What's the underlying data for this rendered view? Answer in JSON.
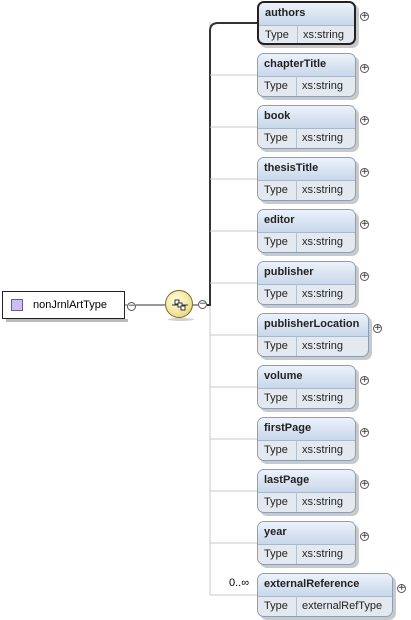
{
  "root_type": {
    "name": "nonJrnlArtType"
  },
  "elements": [
    {
      "name": "authors",
      "type_label": "Type",
      "type_value": "xs:string",
      "selected": true
    },
    {
      "name": "chapterTitle",
      "type_label": "Type",
      "type_value": "xs:string"
    },
    {
      "name": "book",
      "type_label": "Type",
      "type_value": "xs:string"
    },
    {
      "name": "thesisTitle",
      "type_label": "Type",
      "type_value": "xs:string"
    },
    {
      "name": "editor",
      "type_label": "Type",
      "type_value": "xs:string"
    },
    {
      "name": "publisher",
      "type_label": "Type",
      "type_value": "xs:string"
    },
    {
      "name": "publisherLocation",
      "type_label": "Type",
      "type_value": "xs:string"
    },
    {
      "name": "volume",
      "type_label": "Type",
      "type_value": "xs:string"
    },
    {
      "name": "firstPage",
      "type_label": "Type",
      "type_value": "xs:string"
    },
    {
      "name": "lastPage",
      "type_label": "Type",
      "type_value": "xs:string"
    },
    {
      "name": "year",
      "type_label": "Type",
      "type_value": "xs:string"
    },
    {
      "name": "externalReference",
      "type_label": "Type",
      "type_value": "externalRefType",
      "occurrence": "0..∞"
    }
  ],
  "colors": {
    "element_header": "#c8d7ea",
    "element_body": "#e4e9ef",
    "compositor": "#f3e7a0",
    "type_icon": "#cabff0"
  },
  "icons": {
    "compositor": "sequence-compositor-icon",
    "expand": "plus-icon",
    "collapse": "minus-icon",
    "complex_type": "complex-type-icon"
  }
}
